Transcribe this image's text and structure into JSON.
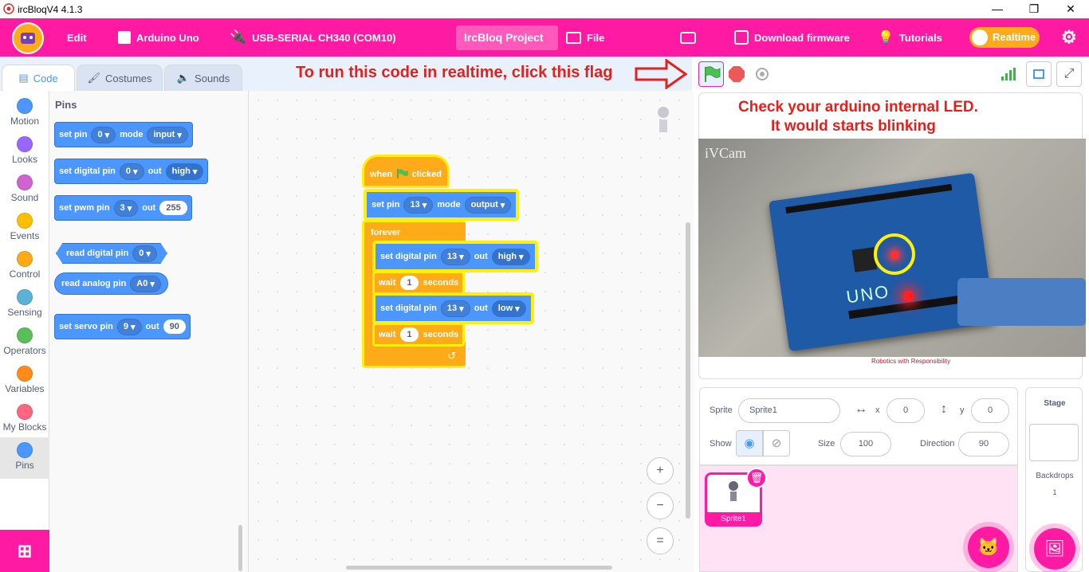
{
  "window": {
    "title": "ircBloqV4 4.1.3",
    "minimize": "—",
    "restore": "❐",
    "close": "✕"
  },
  "menu": {
    "edit": "Edit",
    "board": "Arduino Uno",
    "port": "USB-SERIAL CH340 (COM10)",
    "project": "IrcBloq Project",
    "file": "File",
    "download": "Download firmware",
    "tutorials": "Tutorials",
    "realtime": "Realtime"
  },
  "tabs": {
    "code": "Code",
    "costumes": "Costumes",
    "sounds": "Sounds"
  },
  "annotation": {
    "flag_hint": "To run this code in realtime, click this flag",
    "led_hint_line1": "Check your arduino internal LED.",
    "led_hint_line2": "It would starts blinking"
  },
  "categories": [
    {
      "label": "Motion",
      "color": "#4c97ff"
    },
    {
      "label": "Looks",
      "color": "#9966ff"
    },
    {
      "label": "Sound",
      "color": "#cf63cf"
    },
    {
      "label": "Events",
      "color": "#ffbf00"
    },
    {
      "label": "Control",
      "color": "#ffab19"
    },
    {
      "label": "Sensing",
      "color": "#5cb1d6"
    },
    {
      "label": "Operators",
      "color": "#59c059"
    },
    {
      "label": "Variables",
      "color": "#ff8c1a"
    },
    {
      "label": "My Blocks",
      "color": "#ff6680"
    },
    {
      "label": "Pins",
      "color": "#4c97ff"
    }
  ],
  "flyout": {
    "heading": "Pins",
    "set_pin": {
      "t1": "set pin",
      "pin": "0",
      "t2": "mode",
      "mode": "input"
    },
    "set_digital": {
      "t1": "set digital pin",
      "pin": "0",
      "t2": "out",
      "val": "high"
    },
    "set_pwm": {
      "t1": "set pwm pin",
      "pin": "3",
      "t2": "out",
      "val": "255"
    },
    "read_digital": {
      "t1": "read digital pin",
      "pin": "0"
    },
    "read_analog": {
      "t1": "read analog pin",
      "pin": "A0"
    },
    "set_servo": {
      "t1": "set servo pin",
      "pin": "9",
      "t2": "out",
      "val": "90"
    }
  },
  "script": {
    "hat": {
      "t1": "when",
      "t2": "clicked"
    },
    "set_pin": {
      "t1": "set pin",
      "pin": "13",
      "t2": "mode",
      "mode": "output"
    },
    "forever": "forever",
    "dig1": {
      "t1": "set digital pin",
      "pin": "13",
      "t2": "out",
      "val": "high"
    },
    "wait1": {
      "t1": "wait",
      "val": "1",
      "t2": "seconds"
    },
    "dig2": {
      "t1": "set digital pin",
      "pin": "13",
      "t2": "out",
      "val": "low"
    },
    "wait2": {
      "t1": "wait",
      "val": "1",
      "t2": "seconds"
    }
  },
  "zoom": {
    "in": "+",
    "out": "−",
    "reset": "="
  },
  "stage": {
    "cam_label": "iVCam",
    "board_text": "UNO",
    "caption": "Robotics with Responsibility"
  },
  "sprite": {
    "sprite_label": "Sprite",
    "name": "Sprite1",
    "x_label": "x",
    "x": "0",
    "y_label": "y",
    "y": "0",
    "show_label": "Show",
    "size_label": "Size",
    "size": "100",
    "direction_label": "Direction",
    "direction": "90",
    "tile_name": "Sprite1"
  },
  "stagepanel": {
    "title": "Stage",
    "backdrops_label": "Backdrops",
    "backdrops_count": "1"
  }
}
